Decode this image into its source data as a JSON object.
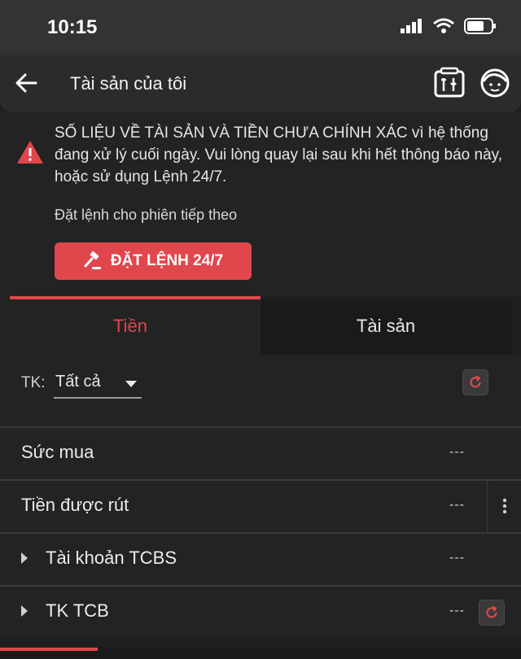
{
  "status_bar": {
    "time": "10:15"
  },
  "header": {
    "title": "Tài sản của tôi"
  },
  "notice": {
    "message": "SỐ LIỆU VỀ TÀI SẢN VÀ TIỀN CHƯA CHÍNH XÁC vì hệ thống đang xử lý cuối ngày. Vui lòng quay lại sau khi hết thông báo này, hoặc sử dụng Lệnh 24/7.",
    "next_session": "Đặt lệnh cho phiên tiếp theo",
    "order_button": "ĐẶT LỆNH 24/7"
  },
  "tabs": {
    "cash": "Tiền",
    "assets": "Tài sản"
  },
  "account": {
    "label": "TK:",
    "selected": "Tất cả"
  },
  "rows": {
    "buying_power": {
      "label": "Sức mua",
      "value": "---"
    },
    "withdrawable": {
      "label": "Tiền được rút",
      "value": "---"
    },
    "tcbs_account": {
      "label": "Tài khoản TCBS",
      "value": "---"
    },
    "tcb_account": {
      "label": "TK TCB",
      "value": "---"
    }
  },
  "colors": {
    "accent": "#e0474c",
    "background": "#1f1f1f"
  },
  "icons": [
    "back-arrow-icon",
    "tools-icon",
    "support-agent-icon",
    "warning-icon",
    "gavel-icon",
    "refresh-icon",
    "more-vertical-icon"
  ]
}
